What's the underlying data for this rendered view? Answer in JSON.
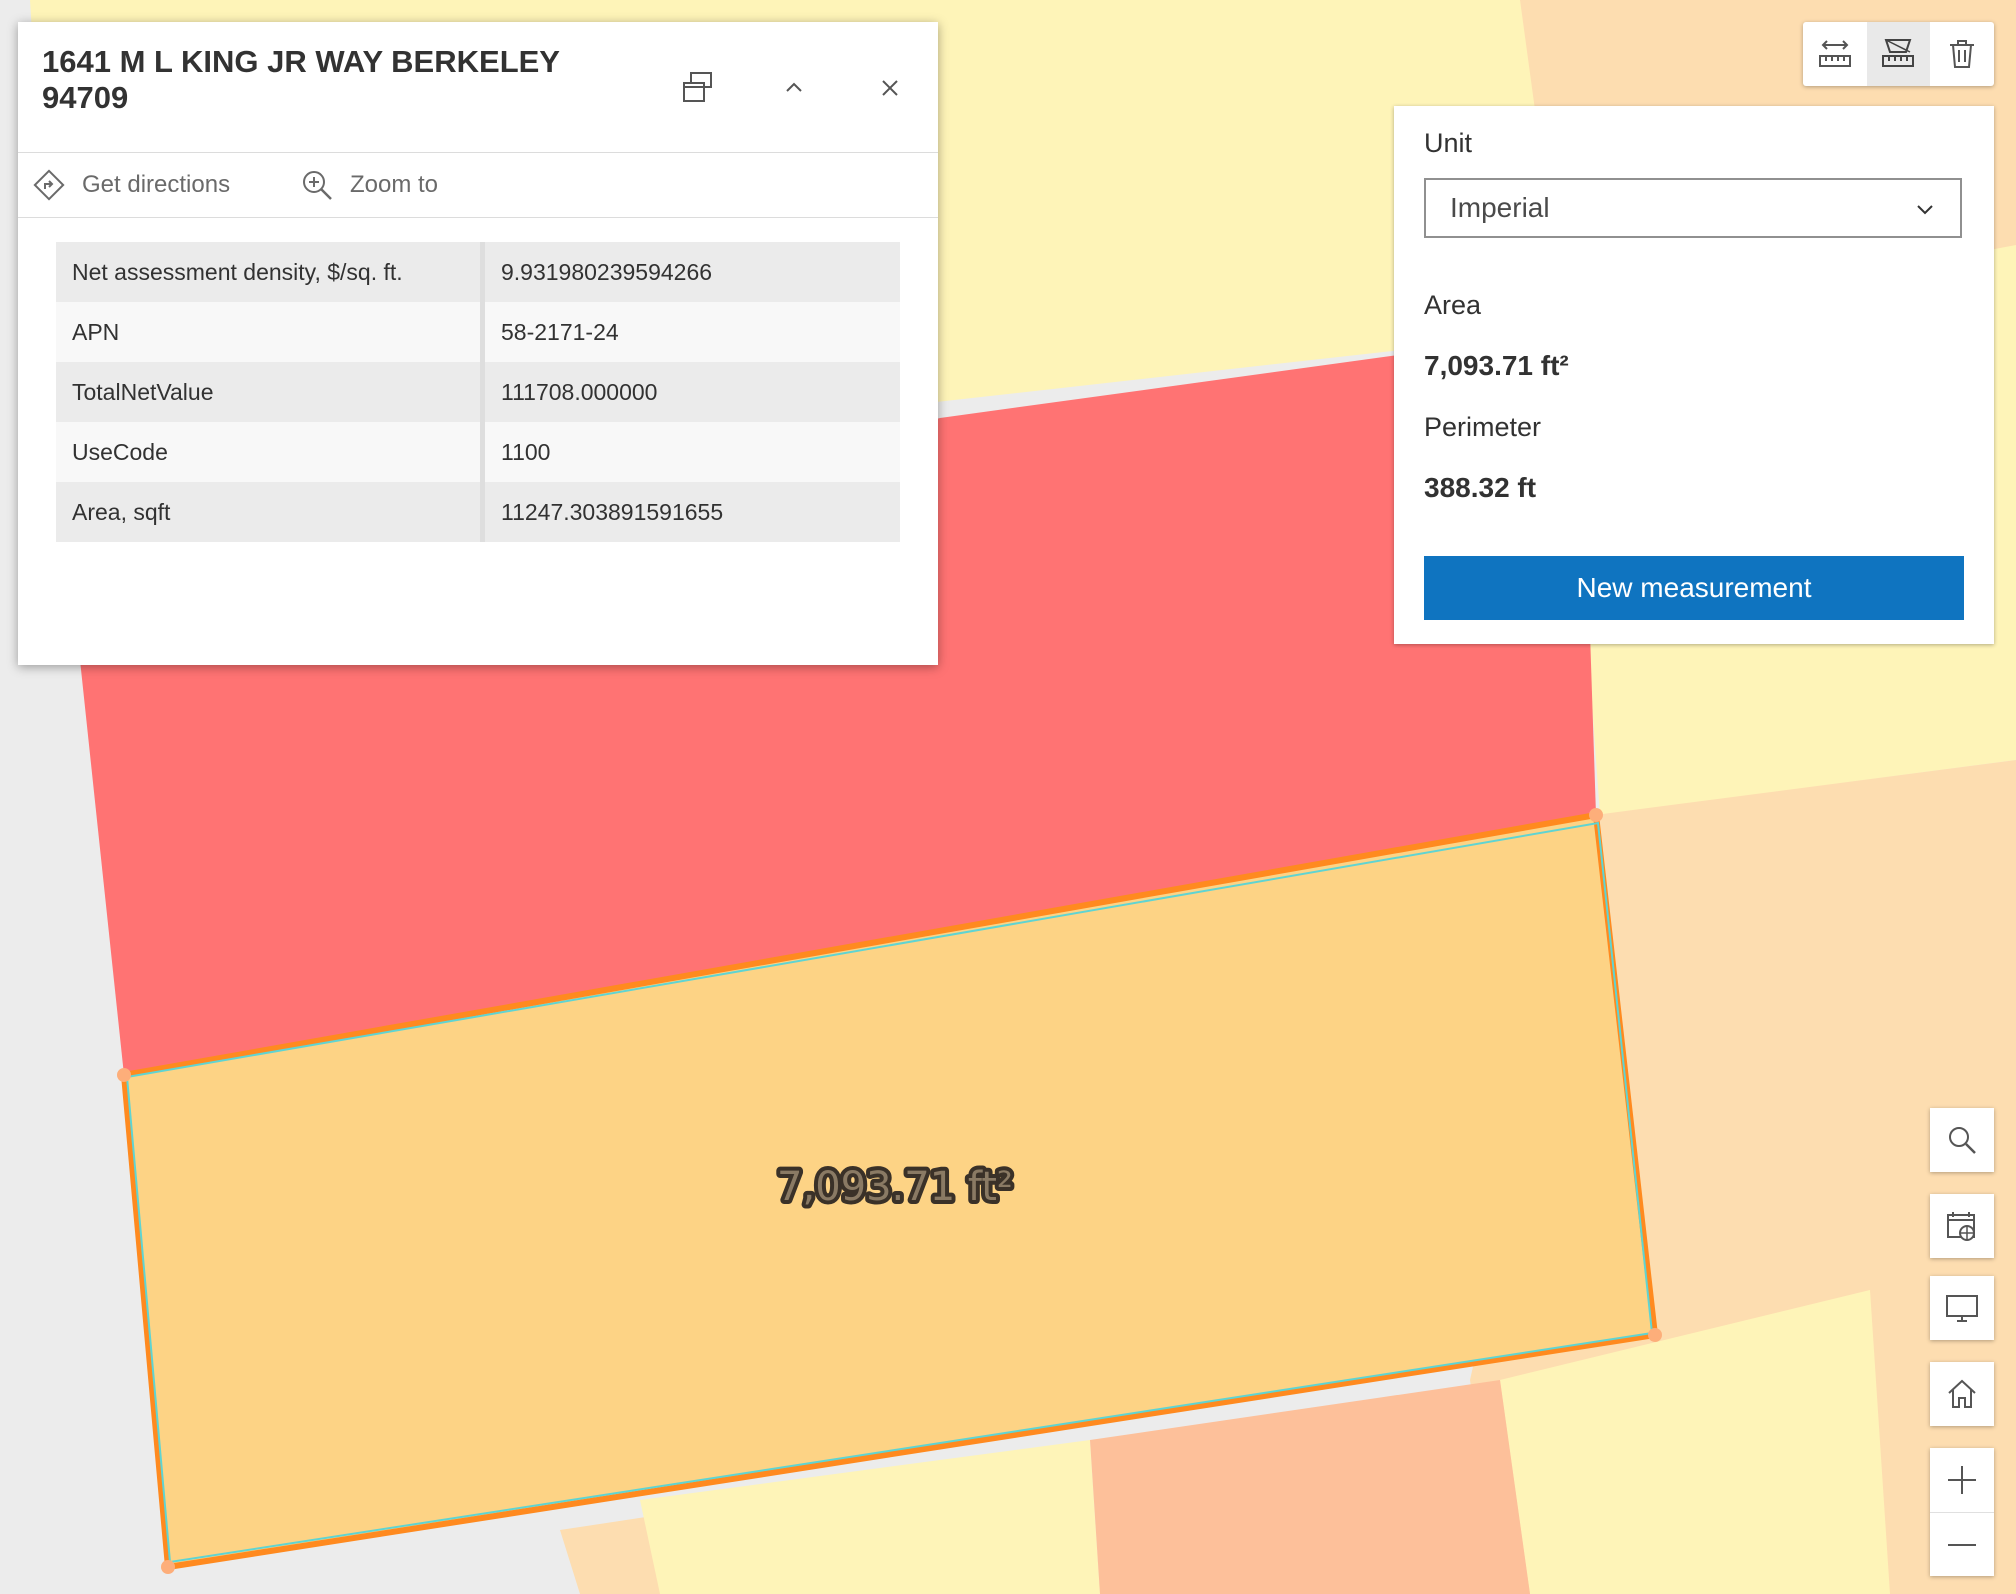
{
  "popup": {
    "title": "1641 M L KING JR WAY BERKELEY 94709",
    "actions": {
      "directions": "Get directions",
      "zoom": "Zoom to"
    },
    "attributes": [
      {
        "key": "Net assessment density, $/sq. ft.",
        "value": "9.931980239594266"
      },
      {
        "key": "APN",
        "value": "58-2171-24"
      },
      {
        "key": "TotalNetValue",
        "value": "111708.000000"
      },
      {
        "key": "UseCode",
        "value": "1100"
      },
      {
        "key": "Area, sqft",
        "value": "11247.303891591655"
      }
    ]
  },
  "measurement": {
    "unit_label": "Unit",
    "unit_value": "Imperial",
    "area_label": "Area",
    "area_value": "7,093.71 ft²",
    "perimeter_label": "Perimeter",
    "perimeter_value": "388.32 ft",
    "new_button": "New measurement"
  },
  "map": {
    "area_label": "7,093.71 ft²",
    "colors": {
      "red_parcel": "#ff7373",
      "selected_parcel": "#fdd385",
      "light_yellow": "#fef4b8",
      "peach": "#fdddb0",
      "salmon": "#fdc09a",
      "outline_orange": "#ff8a1f",
      "outline_cyan": "#5fd4d2"
    }
  },
  "icons": {
    "toolbar": [
      "distance-measure-icon",
      "area-measure-icon",
      "trash-icon"
    ],
    "controls": [
      "search-icon",
      "basemap-gallery-icon",
      "fullscreen-icon",
      "home-icon",
      "zoom-in-icon",
      "zoom-out-icon"
    ]
  }
}
